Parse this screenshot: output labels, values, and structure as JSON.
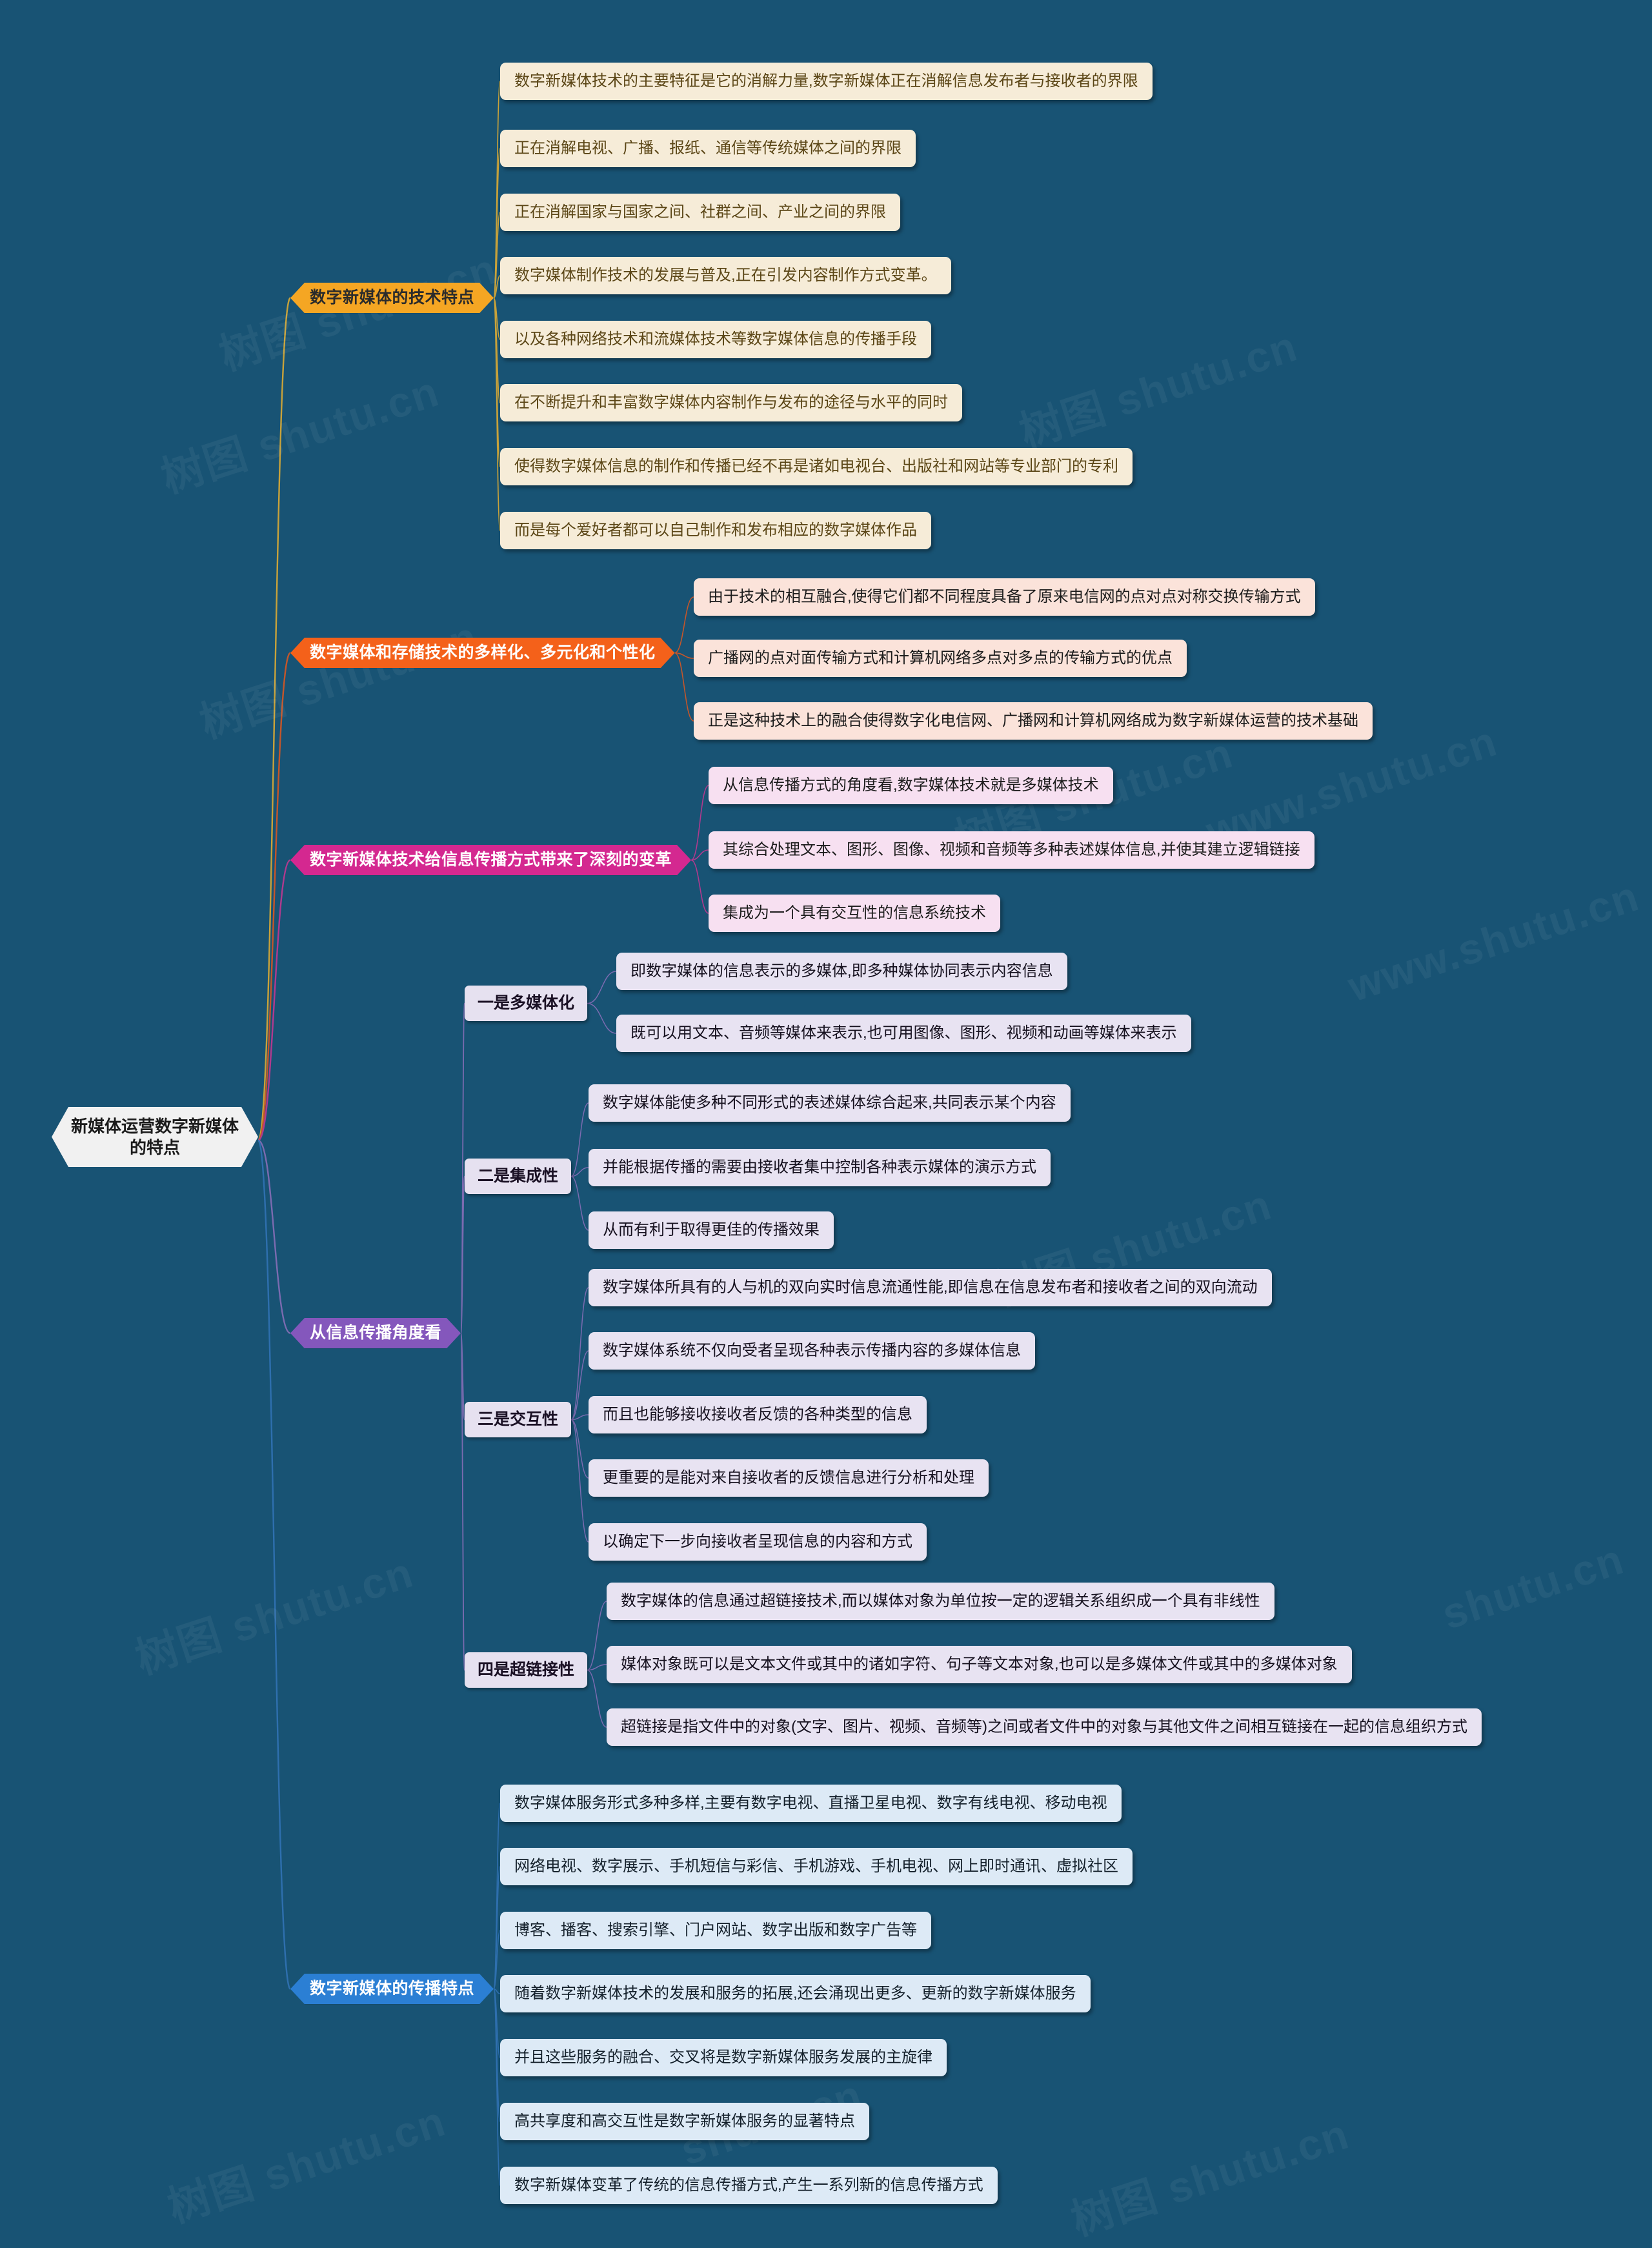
{
  "root": {
    "label": "新媒体运营数字新媒体的特点"
  },
  "watermarks": [
    "树图 shutu.cn",
    "树图 shutu.cn",
    "树图 shutu.cn",
    "树图 shutu.cn",
    "www.shutu.cn",
    "树图 shutu.cn",
    "树图 shutu.cn",
    "www.shutu.cn",
    "树图 shutu.cn",
    "shutu.cn",
    "shutu.cn"
  ],
  "colors": {
    "background": "#185374",
    "root_bg": "#F1F1F1",
    "branch_yellow": "#F5A623",
    "branch_orange": "#F4611A",
    "branch_magenta": "#D42890",
    "branch_purple": "#8457BC",
    "branch_blue": "#2B7FD4",
    "leaf_cream": "#F6ECD8",
    "leaf_peach": "#FBE3DA",
    "leaf_pink": "#F7E0F1",
    "leaf_lavender": "#E8E3F2",
    "leaf_ice": "#DDEAF6"
  },
  "branches": [
    {
      "id": "tech-features",
      "label": "数字新媒体的技术特点",
      "leaves": [
        "数字新媒体技术的主要特征是它的消解力量,数字新媒体正在消解信息发布者与接收者的界限",
        "正在消解电视、广播、报纸、通信等传统媒体之间的界限",
        "正在消解国家与国家之间、社群之间、产业之间的界限",
        "数字媒体制作技术的发展与普及,正在引发内容制作方式变革。",
        "以及各种网络技术和流媒体技术等数字媒体信息的传播手段",
        "在不断提升和丰富数字媒体内容制作与发布的途径与水平的同时",
        "使得数字媒体信息的制作和传播已经不再是诸如电视台、出版社和网站等专业部门的专利",
        "而是每个爱好者都可以自己制作和发布相应的数字媒体作品"
      ]
    },
    {
      "id": "storage-diversity",
      "label": "数字媒体和存储技术的多样化、多元化和个性化",
      "leaves": [
        "由于技术的相互融合,使得它们都不同程度具备了原来电信网的点对点对称交换传输方式",
        "广播网的点对面传输方式和计算机网络多点对多点的传输方式的优点",
        "正是这种技术上的融合使得数字化电信网、广播网和计算机网络成为数字新媒体运营的技术基础"
      ]
    },
    {
      "id": "comm-revolution",
      "label": "数字新媒体技术给信息传播方式带来了深刻的变革",
      "leaves": [
        "从信息传播方式的角度看,数字媒体技术就是多媒体技术",
        "其综合处理文本、图形、图像、视频和音频等多种表述媒体信息,并使其建立逻辑链接",
        "集成为一个具有交互性的信息系统技术"
      ]
    },
    {
      "id": "from-comm-angle",
      "label": "从信息传播角度看",
      "subs": [
        {
          "id": "multimedia",
          "label": "一是多媒体化",
          "leaves": [
            "即数字媒体的信息表示的多媒体,即多种媒体协同表示内容信息",
            "既可以用文本、音频等媒体来表示,也可用图像、图形、视频和动画等媒体来表示"
          ]
        },
        {
          "id": "integration",
          "label": "二是集成性",
          "leaves": [
            "数字媒体能使多种不同形式的表述媒体综合起来,共同表示某个内容",
            "并能根据传播的需要由接收者集中控制各种表示媒体的演示方式",
            "从而有利于取得更佳的传播效果"
          ]
        },
        {
          "id": "interactivity",
          "label": "三是交互性",
          "leaves": [
            "数字媒体所具有的人与机的双向实时信息流通性能,即信息在信息发布者和接收者之间的双向流动",
            "数字媒体系统不仅向受者呈现各种表示传播内容的多媒体信息",
            "而且也能够接收接收者反馈的各种类型的信息",
            "更重要的是能对来自接收者的反馈信息进行分析和处理",
            "以确定下一步向接收者呈现信息的内容和方式"
          ]
        },
        {
          "id": "hyperlink",
          "label": "四是超链接性",
          "leaves": [
            "数字媒体的信息通过超链接技术,而以媒体对象为单位按一定的逻辑关系组织成一个具有非线性",
            "媒体对象既可以是文本文件或其中的诸如字符、句子等文本对象,也可以是多媒体文件或其中的多媒体对象",
            "超链接是指文件中的对象(文字、图片、视频、音频等)之间或者文件中的对象与其他文件之间相互链接在一起的信息组织方式"
          ]
        }
      ]
    },
    {
      "id": "dissemination-features",
      "label": "数字新媒体的传播特点",
      "leaves": [
        "数字媒体服务形式多种多样,主要有数字电视、直播卫星电视、数字有线电视、移动电视",
        "网络电视、数字展示、手机短信与彩信、手机游戏、手机电视、网上即时通讯、虚拟社区",
        "博客、播客、搜索引擎、门户网站、数字出版和数字广告等",
        "随着数字新媒体技术的发展和服务的拓展,还会涌现出更多、更新的数字新媒体服务",
        "并且这些服务的融合、交叉将是数字新媒体服务发展的主旋律",
        "高共享度和高交互性是数字新媒体服务的显著特点",
        "数字新媒体变革了传统的信息传播方式,产生一系列新的信息传播方式"
      ]
    }
  ]
}
